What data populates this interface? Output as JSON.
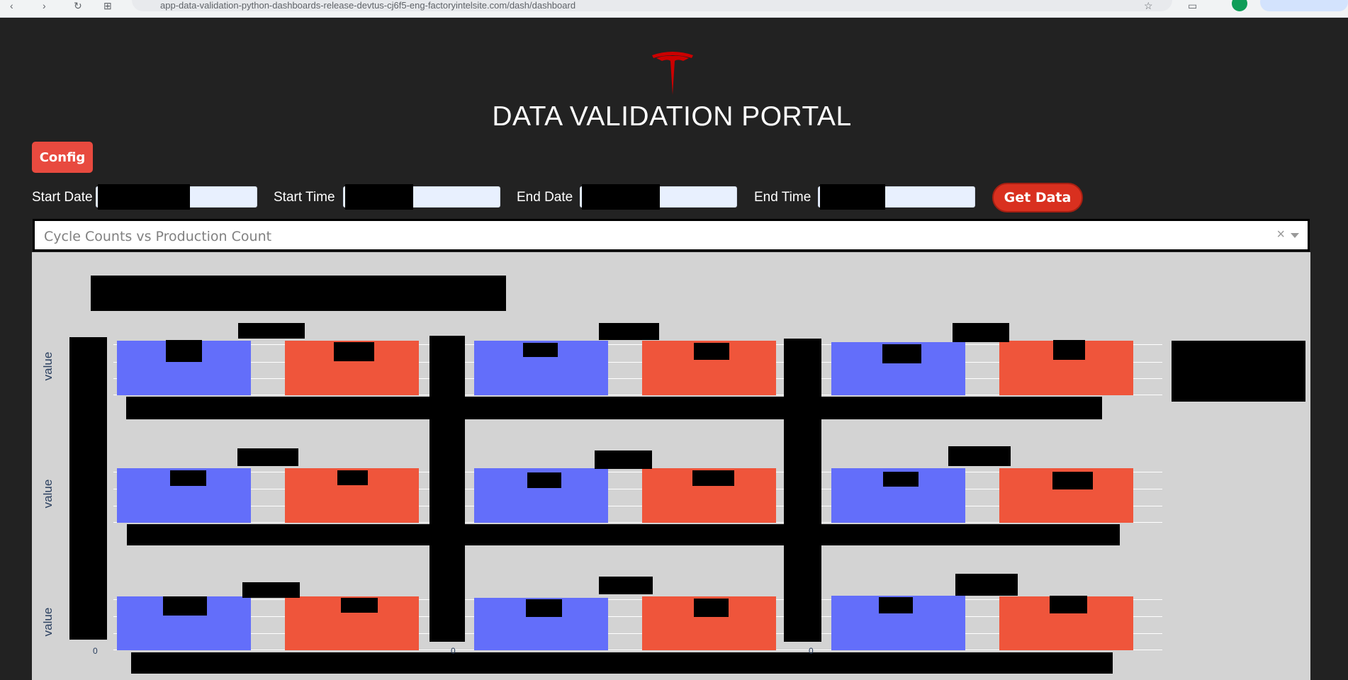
{
  "browser": {
    "url": "app-data-validation-python-dashboards-release-devtus-cj6f5-eng-factoryintelsite.com/dash/dashboard"
  },
  "header": {
    "logo": "tesla-logo-icon",
    "title": "DATA VALIDATION PORTAL"
  },
  "toolbar": {
    "config_label": "Config",
    "get_data_label": "Get Data"
  },
  "filters": {
    "start_date_label": "Start Date",
    "start_time_label": "Start Time",
    "end_date_label": "End Date",
    "end_time_label": "End Time"
  },
  "metric_select": {
    "value": "Cycle Counts vs Production Count",
    "clear": "×"
  },
  "chart": {
    "ylabel_row1": "value",
    "ylabel_row2": "value",
    "ylabel_row3": "value",
    "x_tick_zero": "0",
    "colors": {
      "series_a": "#636efa",
      "series_b": "#ef553b",
      "background": "#d3d3d3"
    }
  }
}
